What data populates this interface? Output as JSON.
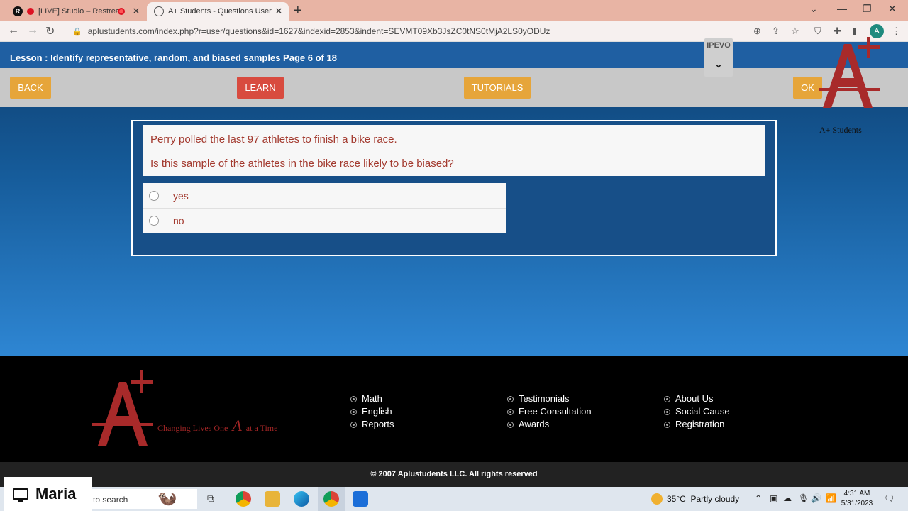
{
  "browser": {
    "tabs": [
      {
        "title": "[LIVE] Studio – Restream",
        "favicon": "R"
      },
      {
        "title": "A+ Students - Questions User"
      }
    ],
    "url": "aplustudents.com/index.php?r=user/questions&id=1627&indexid=2853&indent=SEVMT09Xb3JsZC0tNS0tMjA2LS0yODUz",
    "profile_initial": "A"
  },
  "lesson": {
    "title": "Lesson : Identify representative, random, and biased samples Page 6 of 18"
  },
  "buttons": {
    "back": "BACK",
    "learn": "LEARN",
    "tutorials": "TUTORIALS",
    "ok": "OK"
  },
  "overlay": {
    "ipevo": "IPEVO"
  },
  "brand": {
    "caption": "A+ Students",
    "tagline_pre": "Changing Lives One",
    "tagline_mark": "A",
    "tagline_post": "at a Time"
  },
  "question": {
    "line1": "Perry polled the last 97 athletes to finish a bike race.",
    "line2": "Is this sample of the athletes in the bike race likely to be biased?",
    "options": [
      "yes",
      "no"
    ]
  },
  "footer": {
    "col1": [
      "Math",
      "English",
      "Reports"
    ],
    "col2": [
      "Testimonials",
      "Free Consultation",
      "Awards"
    ],
    "col3": [
      "About Us",
      "Social Cause",
      "Registration"
    ],
    "copyright": "© 2007 Aplustudents LLC. All rights reserved"
  },
  "taskbar": {
    "search_placeholder": "to search",
    "weather_temp": "35°C",
    "weather_desc": "Partly cloudy",
    "time": "4:31 AM",
    "date": "5/31/2023"
  },
  "overlay_name": "Maria",
  "colors": {
    "accent_orange": "#e6a53a",
    "accent_red": "#d84b3f",
    "question_text": "#a33a2f"
  }
}
